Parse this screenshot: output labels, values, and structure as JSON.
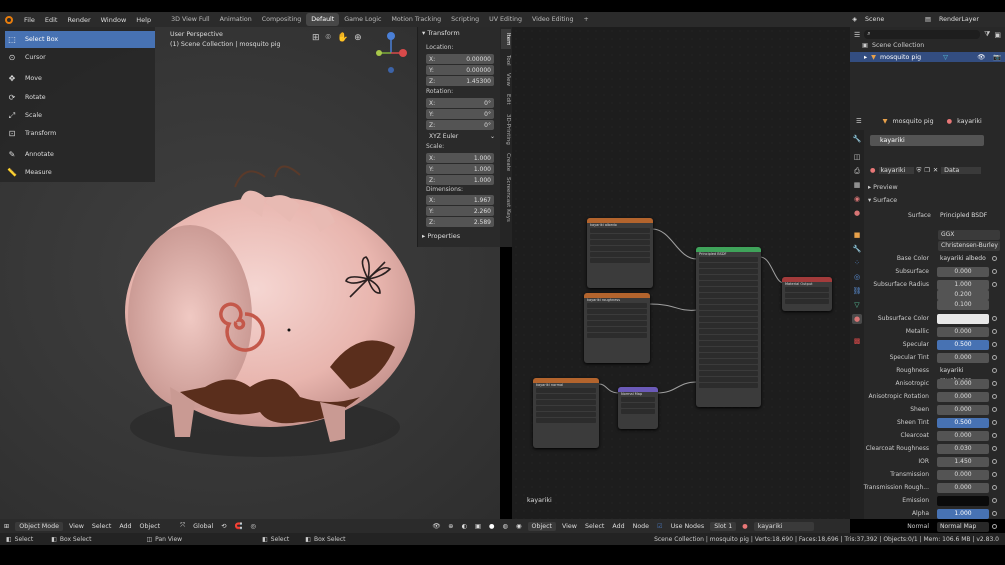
{
  "topbar": {
    "menus": [
      "File",
      "Edit",
      "Render",
      "Window",
      "Help"
    ],
    "workspaces": [
      "3D View Full",
      "Animation",
      "Compositing",
      "Default",
      "Game Logic",
      "Motion Tracking",
      "Scripting",
      "UV Editing",
      "Video Editing"
    ],
    "active_workspace": "Default",
    "add_tab": "+",
    "scene": "Scene",
    "view_layer": "RenderLayer"
  },
  "viewport": {
    "title": "User Perspective",
    "subtitle": "(1) Scene Collection | mosquito pig"
  },
  "tools": [
    "Select Box",
    "Cursor",
    "Move",
    "Rotate",
    "Scale",
    "Transform",
    "Annotate",
    "Measure"
  ],
  "npanel": {
    "transform_header": "Transform",
    "location_label": "Location:",
    "location": [
      {
        "axis": "X:",
        "value": "0.00000"
      },
      {
        "axis": "Y:",
        "value": "0.00000"
      },
      {
        "axis": "Z:",
        "value": "1.45300"
      }
    ],
    "rotation_label": "Rotation:",
    "rotation": [
      {
        "axis": "X:",
        "value": "0°"
      },
      {
        "axis": "Y:",
        "value": "0°"
      },
      {
        "axis": "Z:",
        "value": "0°"
      }
    ],
    "rotation_mode": "XYZ Euler",
    "scale_label": "Scale:",
    "scale": [
      {
        "axis": "X:",
        "value": "1.000"
      },
      {
        "axis": "Y:",
        "value": "1.000"
      },
      {
        "axis": "Z:",
        "value": "1.000"
      }
    ],
    "dimensions_label": "Dimensions:",
    "dimensions": [
      {
        "axis": "X:",
        "value": "1.967"
      },
      {
        "axis": "Y:",
        "value": "2.260"
      },
      {
        "axis": "Z:",
        "value": "2.589"
      }
    ],
    "properties_header": "Properties"
  },
  "vtabs": [
    "Item",
    "Tool",
    "View",
    "Edit",
    "3D-Printing",
    "Create",
    "Screencast Keys"
  ],
  "node_editor": {
    "material_name": "kayariki",
    "nodes": [
      {
        "title": "kayariki albedo",
        "color": "#b3642d"
      },
      {
        "title": "Principled BSDF",
        "color": "#3fa35a"
      },
      {
        "title": "Material Output",
        "color": "#a33b3b"
      },
      {
        "title": "kayariki roughness",
        "color": "#b3642d"
      },
      {
        "title": "kayariki normal",
        "color": "#b3642d"
      },
      {
        "title": "Normal Map",
        "color": "#6b5ab8"
      }
    ]
  },
  "outliner": {
    "collection": "Scene Collection",
    "object": "mosquito pig"
  },
  "props": {
    "breadcrumb_object": "mosquito pig",
    "breadcrumb_material": "kayariki",
    "slot": "kayariki",
    "material_field": "kayariki",
    "data_dropdown": "Data",
    "preview": "Preview",
    "surface_header": "Surface",
    "surface_label": "Surface",
    "surface_value": "Principled BSDF",
    "distribution": "GGX",
    "subsurface_method": "Christensen-Burley",
    "rows": [
      {
        "label": "Base Color",
        "value": "kayariki albedo",
        "style": "link"
      },
      {
        "label": "Subsurface",
        "value": "0.000",
        "style": ""
      },
      {
        "label": "Subsurface Radius",
        "value": "1.000",
        "style": ""
      },
      {
        "label": "",
        "value": "0.200",
        "style": ""
      },
      {
        "label": "",
        "value": "0.100",
        "style": ""
      },
      {
        "label": "Subsurface Color",
        "value": "",
        "style": "white"
      },
      {
        "label": "Metallic",
        "value": "0.000",
        "style": ""
      },
      {
        "label": "Specular",
        "value": "0.500",
        "style": "blue"
      },
      {
        "label": "Specular Tint",
        "value": "0.000",
        "style": ""
      },
      {
        "label": "Roughness",
        "value": "kayariki roughness",
        "style": "link"
      },
      {
        "label": "Anisotropic",
        "value": "0.000",
        "style": ""
      },
      {
        "label": "Anisotropic Rotation",
        "value": "0.000",
        "style": ""
      },
      {
        "label": "Sheen",
        "value": "0.000",
        "style": ""
      },
      {
        "label": "Sheen Tint",
        "value": "0.500",
        "style": "blue"
      },
      {
        "label": "Clearcoat",
        "value": "0.000",
        "style": ""
      },
      {
        "label": "Clearcoat Roughness",
        "value": "0.030",
        "style": ""
      },
      {
        "label": "IOR",
        "value": "1.450",
        "style": ""
      },
      {
        "label": "Transmission",
        "value": "0.000",
        "style": ""
      },
      {
        "label": "Transmission Rough...",
        "value": "0.000",
        "style": ""
      },
      {
        "label": "Emission",
        "value": "",
        "style": "black"
      },
      {
        "label": "Alpha",
        "value": "1.000",
        "style": "blue"
      },
      {
        "label": "Normal",
        "value": "Normal Map",
        "style": "link"
      }
    ]
  },
  "vp_header": {
    "mode": "Object Mode",
    "menus": [
      "View",
      "Select",
      "Add",
      "Object"
    ],
    "orientation": "Global"
  },
  "nd_header": {
    "type": "Object",
    "menus": [
      "View",
      "Select",
      "Add",
      "Node"
    ],
    "use_nodes": "Use Nodes",
    "slot": "Slot 1",
    "material": "kayariki"
  },
  "status": {
    "left": [
      "Select",
      "Box Select",
      "Pan View",
      "Select",
      "Box Select"
    ],
    "right": "Scene Collection | mosquito pig | Verts:18,690 | Faces:18,696 | Tris:37,392 | Objects:0/1 | Mem: 106.6 MB | v2.83.0"
  }
}
